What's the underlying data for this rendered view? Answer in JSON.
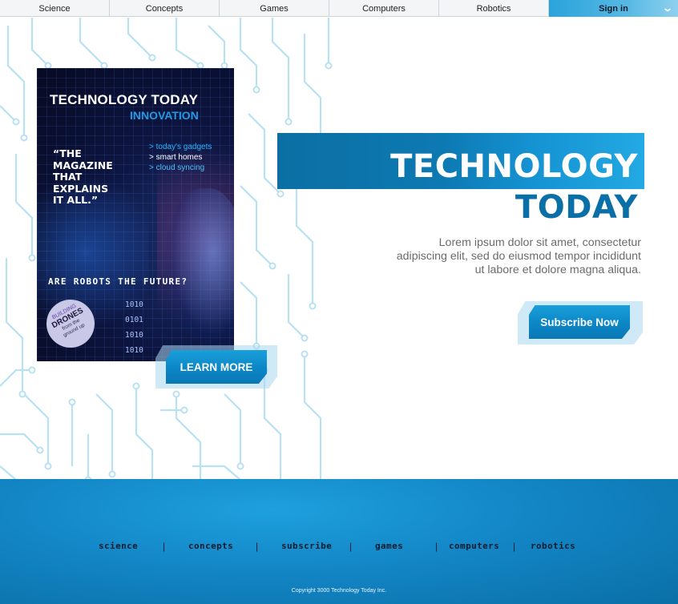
{
  "nav": {
    "items": [
      {
        "label": "Science"
      },
      {
        "label": "Concepts"
      },
      {
        "label": "Games"
      },
      {
        "label": "Computers"
      },
      {
        "label": "Robotics"
      }
    ],
    "signin_label": "Sign in",
    "signin_icon": "chevron-down-icon"
  },
  "cover": {
    "title": "TECHNOLOGY TODAY",
    "subtitle": "INNOVATION",
    "quote_lines": [
      "“THE",
      "MAGAZINE",
      "THAT",
      "EXPLAINS",
      "IT ALL.”"
    ],
    "list": [
      "> today's gadgets",
      "> smart homes",
      "> cloud syncing"
    ],
    "headline": "ARE ROBOTS THE FUTURE?",
    "binary": "1010\n0101\n1010\n1010",
    "badge": {
      "top": "BUILDING",
      "main": "DRONES",
      "bottom_lines": [
        "from the",
        "ground up"
      ]
    }
  },
  "learn_more_label": "LEARN MORE",
  "hero": {
    "title_line1": "TECHNOLOGY",
    "title_line2": "TODAY",
    "description": "Lorem ipsum dolor sit amet, consectetur adipiscing elit, sed do eiusmod tempor incididunt ut labore et dolore magna aliqua."
  },
  "subscribe_label": "Subscribe Now",
  "footer": {
    "links": [
      {
        "label": "science"
      },
      {
        "label": "concepts"
      },
      {
        "label": "subscribe"
      },
      {
        "label": "games"
      },
      {
        "label": "computers"
      },
      {
        "label": "robotics"
      }
    ],
    "separator": "|",
    "copyright": "Copyright 3000 Technology Today Inc."
  },
  "colors": {
    "accent": "#0c86c6",
    "hero_dark": "#0a6fa6",
    "circuit": "#b8e1f2"
  }
}
